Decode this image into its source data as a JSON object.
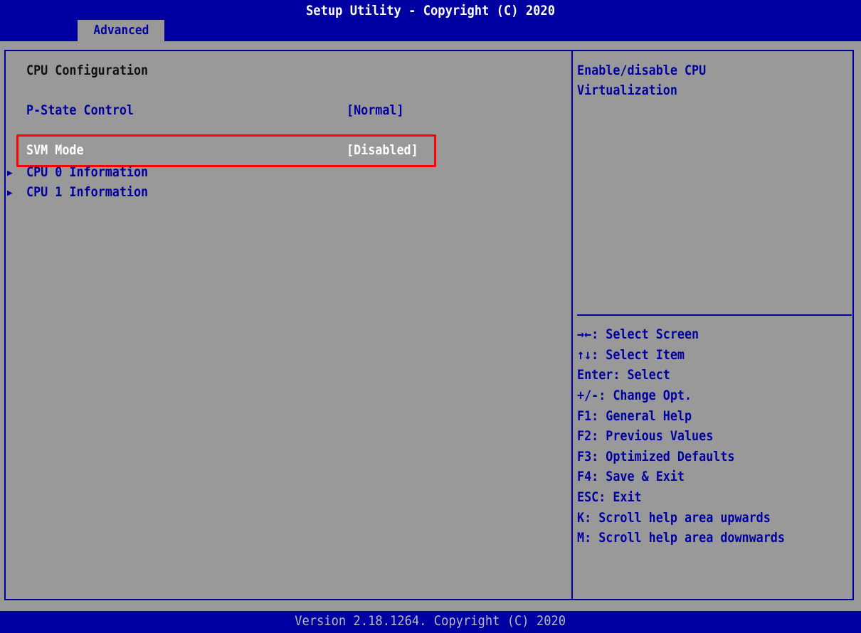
{
  "header": {
    "title": "Setup Utility - Copyright (C) 2020",
    "active_tab": "Advanced"
  },
  "main": {
    "section_title": "CPU Configuration",
    "items": [
      {
        "label": "P-State Control",
        "value": "[Normal]",
        "type": "option"
      },
      {
        "label": "SVM Mode",
        "value": "[Disabled]",
        "type": "option",
        "selected": true
      },
      {
        "label": "CPU 0 Information",
        "type": "submenu",
        "icon": "triangle-right-icon"
      },
      {
        "label": "CPU 1 Information",
        "type": "submenu",
        "icon": "triangle-right-icon"
      }
    ]
  },
  "help": {
    "description": [
      "Enable/disable CPU",
      "Virtualization"
    ],
    "keys": [
      "→←: Select Screen",
      "↑↓: Select Item",
      "Enter: Select",
      "+/-: Change Opt.",
      "F1: General Help",
      "F2: Previous Values",
      "F3: Optimized Defaults",
      "F4: Save & Exit",
      "ESC: Exit",
      "K: Scroll help area upwards",
      "M: Scroll help area downwards"
    ]
  },
  "footer": {
    "version": "Version 2.18.1264. Copyright (C) 2020"
  },
  "colors": {
    "bios_blue": "#0000a2",
    "background_gray": "#999999",
    "highlight_red": "#ff0000"
  }
}
